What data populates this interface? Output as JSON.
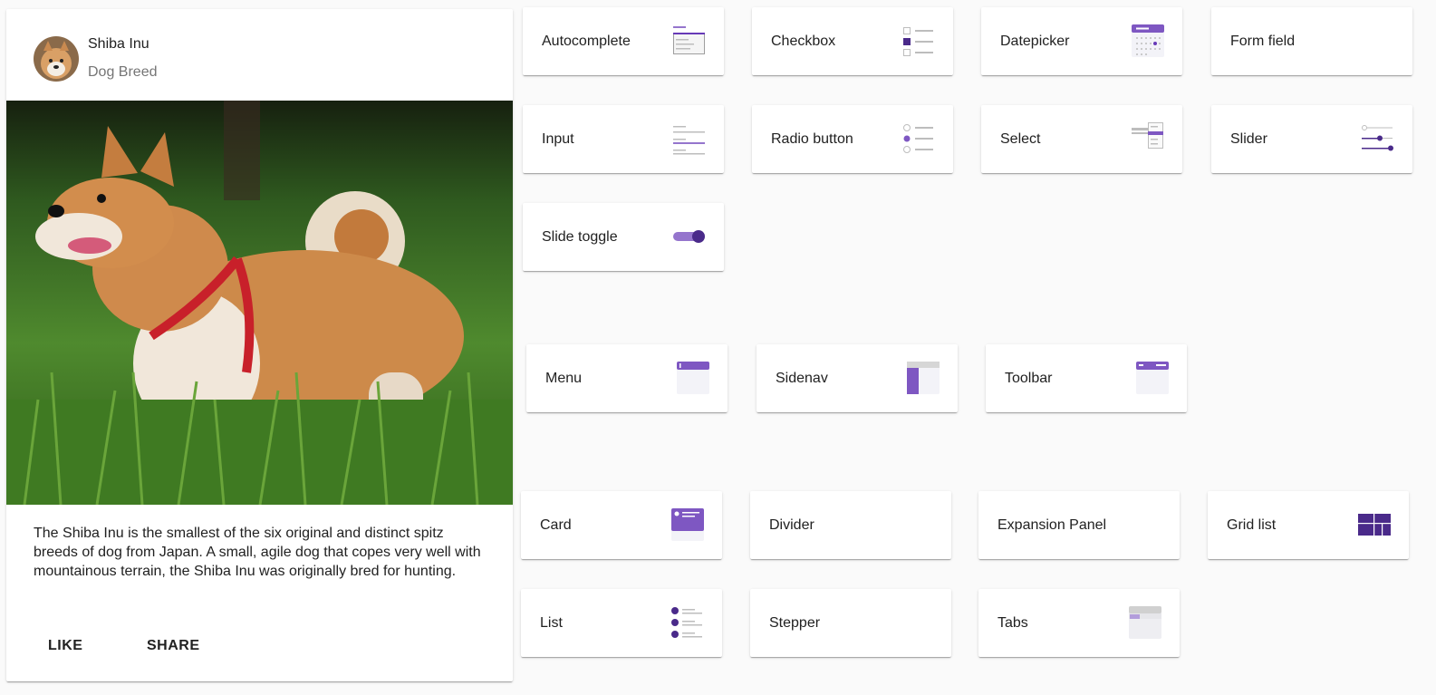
{
  "card": {
    "title": "Shiba Inu",
    "subtitle": "Dog Breed",
    "description": "The Shiba Inu is the smallest of the six original and distinct spitz breeds of dog from Japan. A small, agile dog that copes very well with mountainous terrain, the Shiba Inu was originally bred for hunting.",
    "actions": {
      "like": "LIKE",
      "share": "SHARE"
    }
  },
  "tiles": {
    "form": [
      {
        "label": "Autocomplete",
        "icon": "autocomplete-icon"
      },
      {
        "label": "Checkbox",
        "icon": "checkbox-icon"
      },
      {
        "label": "Datepicker",
        "icon": "datepicker-icon"
      },
      {
        "label": "Form field",
        "icon": ""
      },
      {
        "label": "Input",
        "icon": "input-icon"
      },
      {
        "label": "Radio button",
        "icon": "radio-button-icon"
      },
      {
        "label": "Select",
        "icon": "select-icon"
      },
      {
        "label": "Slider",
        "icon": "slider-icon"
      },
      {
        "label": "Slide toggle",
        "icon": "slide-toggle-icon"
      }
    ],
    "navigation": [
      {
        "label": "Menu",
        "icon": "menu-icon"
      },
      {
        "label": "Sidenav",
        "icon": "sidenav-icon"
      },
      {
        "label": "Toolbar",
        "icon": "toolbar-icon"
      }
    ],
    "layout": [
      {
        "label": "Card",
        "icon": "card-icon"
      },
      {
        "label": "Divider",
        "icon": ""
      },
      {
        "label": "Expansion Panel",
        "icon": ""
      },
      {
        "label": "Grid list",
        "icon": "grid-list-icon"
      },
      {
        "label": "List",
        "icon": "list-icon"
      },
      {
        "label": "Stepper",
        "icon": ""
      },
      {
        "label": "Tabs",
        "icon": "tabs-icon"
      }
    ]
  },
  "colors": {
    "accent": "#673ab7",
    "accent_light": "#9575cd",
    "accent_dark": "#4a2a8a"
  }
}
